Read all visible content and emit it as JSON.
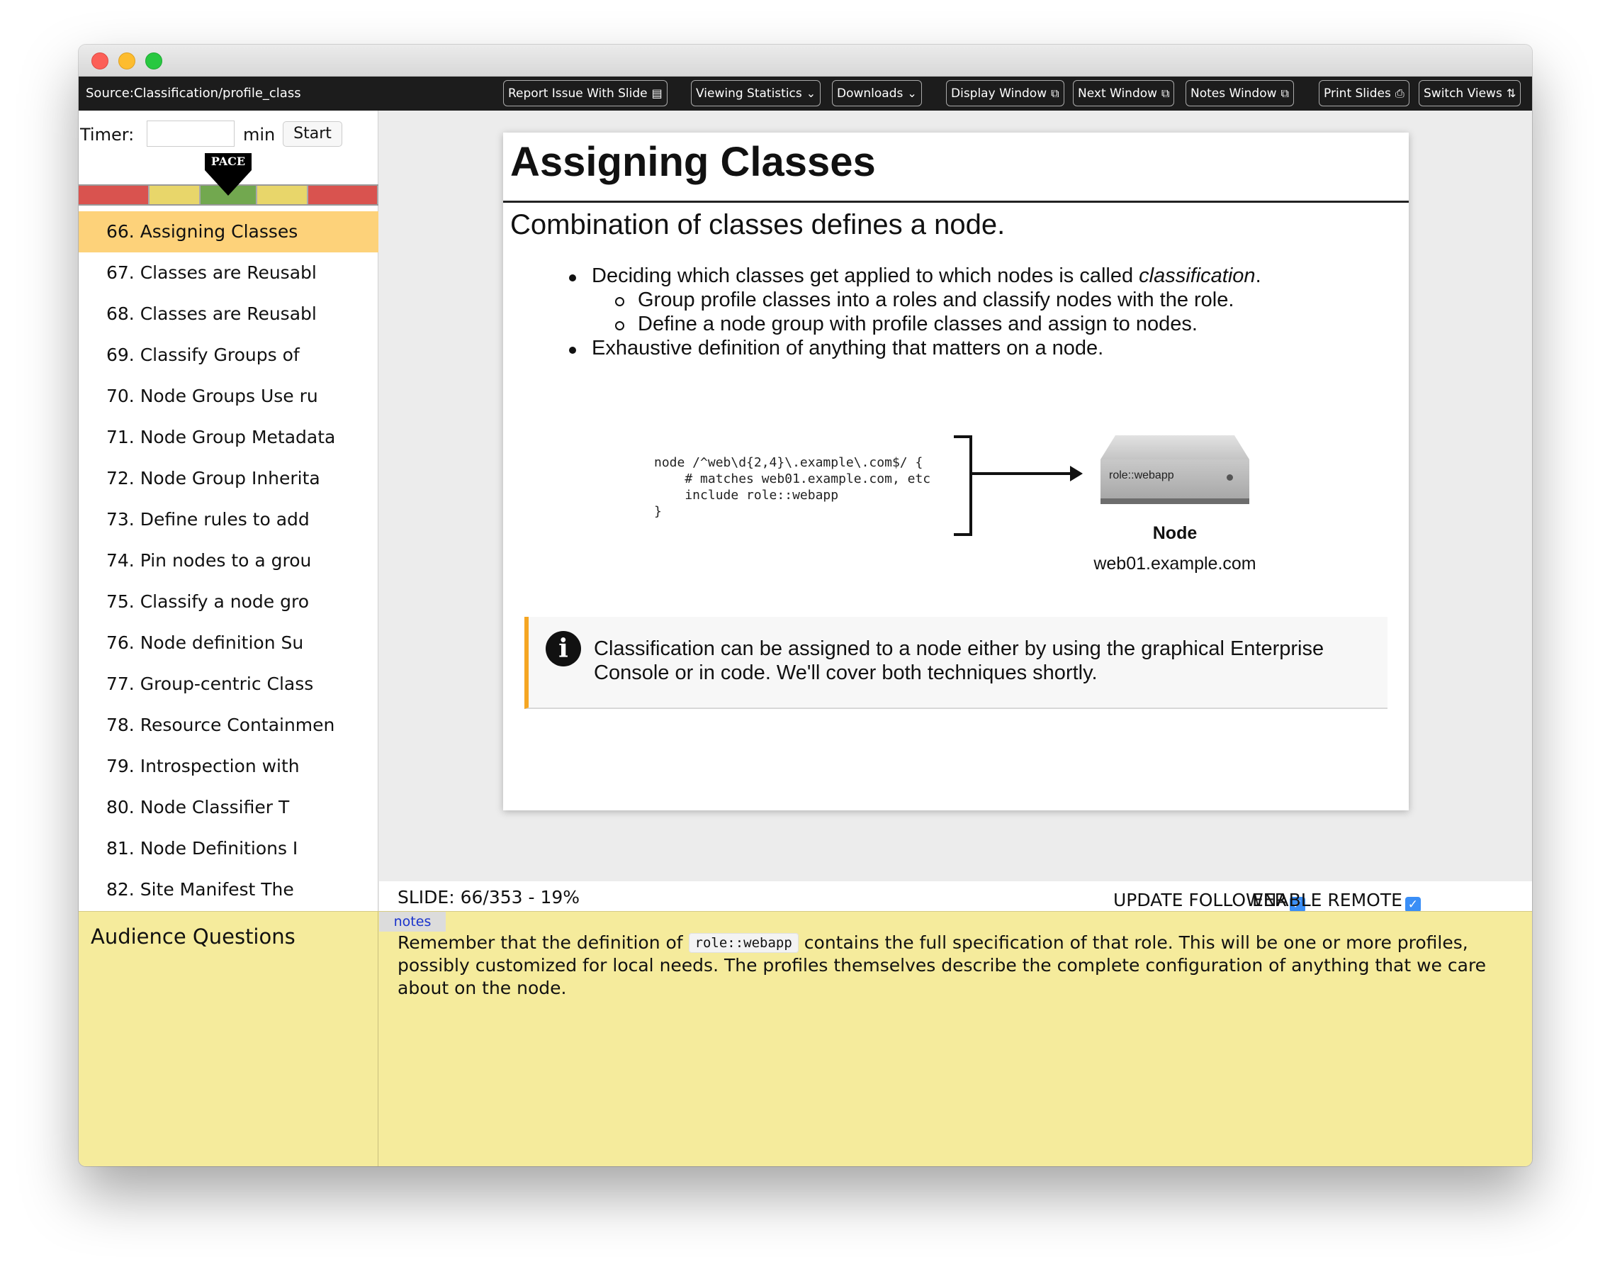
{
  "toolbar": {
    "source": "Source:Classification/profile_class",
    "buttons": {
      "report_issue": "Report Issue With Slide",
      "viewing_statistics": "Viewing Statistics",
      "downloads": "Downloads",
      "display_window": "Display Window",
      "next_window": "Next Window",
      "notes_window": "Notes Window",
      "print_slides": "Print Slides",
      "switch_views": "Switch Views"
    }
  },
  "sidebar": {
    "timer": {
      "label": "Timer:",
      "value": "",
      "unit": "min",
      "start_label": "Start"
    },
    "pace": {
      "label": "PACE",
      "segment_colors": [
        "#d9534f",
        "#e8d66a",
        "#72a84f",
        "#e8d66a",
        "#d9534f"
      ]
    },
    "slides": [
      {
        "label": "66. Assigning Classes",
        "active": true
      },
      {
        "label": "67. Classes are Reusabl"
      },
      {
        "label": "68. Classes are Reusabl"
      },
      {
        "label": "69. Classify Groups of"
      },
      {
        "label": "70. Node Groups Use ru"
      },
      {
        "label": "71. Node Group Metadata"
      },
      {
        "label": "72. Node Group Inherita"
      },
      {
        "label": "73. Define rules to add"
      },
      {
        "label": "74. Pin nodes to a grou"
      },
      {
        "label": "75. Classify a node gro"
      },
      {
        "label": "76. Node definition Su"
      },
      {
        "label": "77. Group-centric Class"
      },
      {
        "label": "78. Resource Containmen"
      },
      {
        "label": "79. Introspection with"
      },
      {
        "label": "80. Node Classifier T"
      },
      {
        "label": "81. Node Definitions I"
      },
      {
        "label": "82. Site Manifest The"
      }
    ]
  },
  "slide": {
    "title": "Assigning Classes",
    "subtitle": "Combination of classes defines a node.",
    "bullets": {
      "b1_text": "Deciding which classes get applied to which nodes is called ",
      "b1_em": "classification",
      "b1_tail": ".",
      "b1a": "Group profile classes into a roles and classify nodes with the role.",
      "b1b": "Define a node group with profile classes and assign to nodes.",
      "b2": "Exhaustive definition of anything that matters on a node."
    },
    "code": "node /^web\\d{2,4}\\.example\\.com$/ {\n    # matches web01.example.com, etc\n    include role::webapp\n}",
    "server_label": "role::webapp",
    "node_title": "Node",
    "node_host": "web01.example.com",
    "callout": "Classification can be assigned to a node either by using the graphical Enterprise Console or in code. We'll cover both techniques shortly."
  },
  "status": {
    "slide_count": "SLIDE: 66/353 - 19%",
    "update_follower": "UPDATE FOLLOWER",
    "enable_remote": "ENABLE REMOTE"
  },
  "bottom": {
    "audience_questions": "Audience Questions",
    "notes_tab": "notes",
    "notes_before": "Remember that the definition of ",
    "notes_code": "role::webapp",
    "notes_after": " contains the full specification of that role. This will be one or more profiles, possibly customized for local needs. The profiles themselves describe the complete configuration of anything that we care about on the node."
  }
}
